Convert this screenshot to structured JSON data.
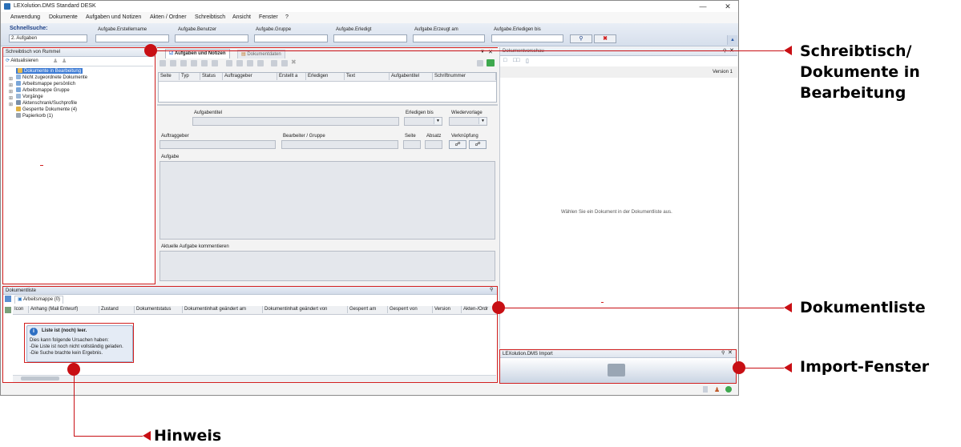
{
  "window": {
    "title": "LEXolution.DMS Standard DESK",
    "min": "—",
    "max": "☐",
    "close": "✕"
  },
  "menu": [
    "Anwendung",
    "Dokumente",
    "Aufgaben und Notizen",
    "Akten / Ordner",
    "Schreibtisch",
    "Ansicht",
    "Fenster",
    "?"
  ],
  "quicksearch": {
    "label": "Schnellsuche:",
    "value": "2. Aufgaben",
    "fields": [
      "Aufgabe.Erstellername",
      "Aufgabe.Benutzer",
      "Aufgabe.Gruppe",
      "Aufgabe.Erledigt",
      "Aufgabe.Erzeugt am",
      "Aufgabe.Erledigen bis"
    ],
    "search_icon": "search-icon",
    "clear_icon": "clear-icon"
  },
  "desk": {
    "title": "Schreibtisch von Rummel",
    "refresh": "Aktualisieren",
    "tree": [
      "Dokumente in Bearbeitung",
      "Nicht zugeordnete Dokumente",
      "Arbeitsmappe persönlich",
      "Arbeitsmappe Gruppe",
      "Vorgänge",
      "Aktenschrank/Suchprofile",
      "Gesperrte Dokumente (4)",
      "Papierkorb (1)"
    ]
  },
  "tasks": {
    "tabs": [
      "Aufgaben und Notizen",
      "Dokumentdaten"
    ],
    "columns": [
      "Seite",
      "Typ",
      "Status",
      "Auftraggeber",
      "Erstellt a",
      "Erledigen",
      "Text",
      "Aufgabentitel",
      "Schriftnummer"
    ],
    "labels": {
      "aufgabentitel": "Aufgabentitel",
      "erledigen_bis": "Erledigen bis",
      "wiedervorlage": "Wiedervorlage",
      "auftraggeber": "Auftraggeber",
      "bearbeiter": "Bearbeiter / Gruppe",
      "seite": "Seite",
      "absatz": "Absatz",
      "verknuepfung": "Verknüpfung",
      "aufgabe": "Aufgabe",
      "kommentieren": "Aktuelle Aufgabe kommentieren"
    }
  },
  "preview": {
    "title": "Dokumentvorschau",
    "version": "Version 1",
    "empty": "Wählen Sie ein Dokument in der Dokumentliste aus."
  },
  "doclist": {
    "title": "Dokumentliste",
    "tab": "Arbeitsmappe (0)",
    "columns": [
      "Icon",
      "Anhang (Mail Entwurf)",
      "Zustand",
      "Dokumentstatus",
      "Dokumentinhalt geändert am",
      "Dokumentinhalt geändert von",
      "Gesperrt am",
      "Gesperrt von",
      "Version",
      "Akten-/Ordr"
    ],
    "hint": {
      "title": "Liste ist (noch) leer.",
      "line1": "Dies kann folgende Ursachen haben:",
      "line2": "-Die Liste ist noch nicht vollständig geladen.",
      "line3": "-Die Suche brachte kein Ergebnis."
    }
  },
  "import": {
    "title": "LEXolution.DMS Import"
  },
  "callouts": {
    "desk": [
      "Schreibtisch/",
      "Dokumente in",
      "Bearbeitung"
    ],
    "doclist": "Dokumentliste",
    "import": "Import-Fenster",
    "hint": "Hinweis"
  },
  "colors": {
    "accent": "#c80f14",
    "selected": "#3d7bd4"
  }
}
